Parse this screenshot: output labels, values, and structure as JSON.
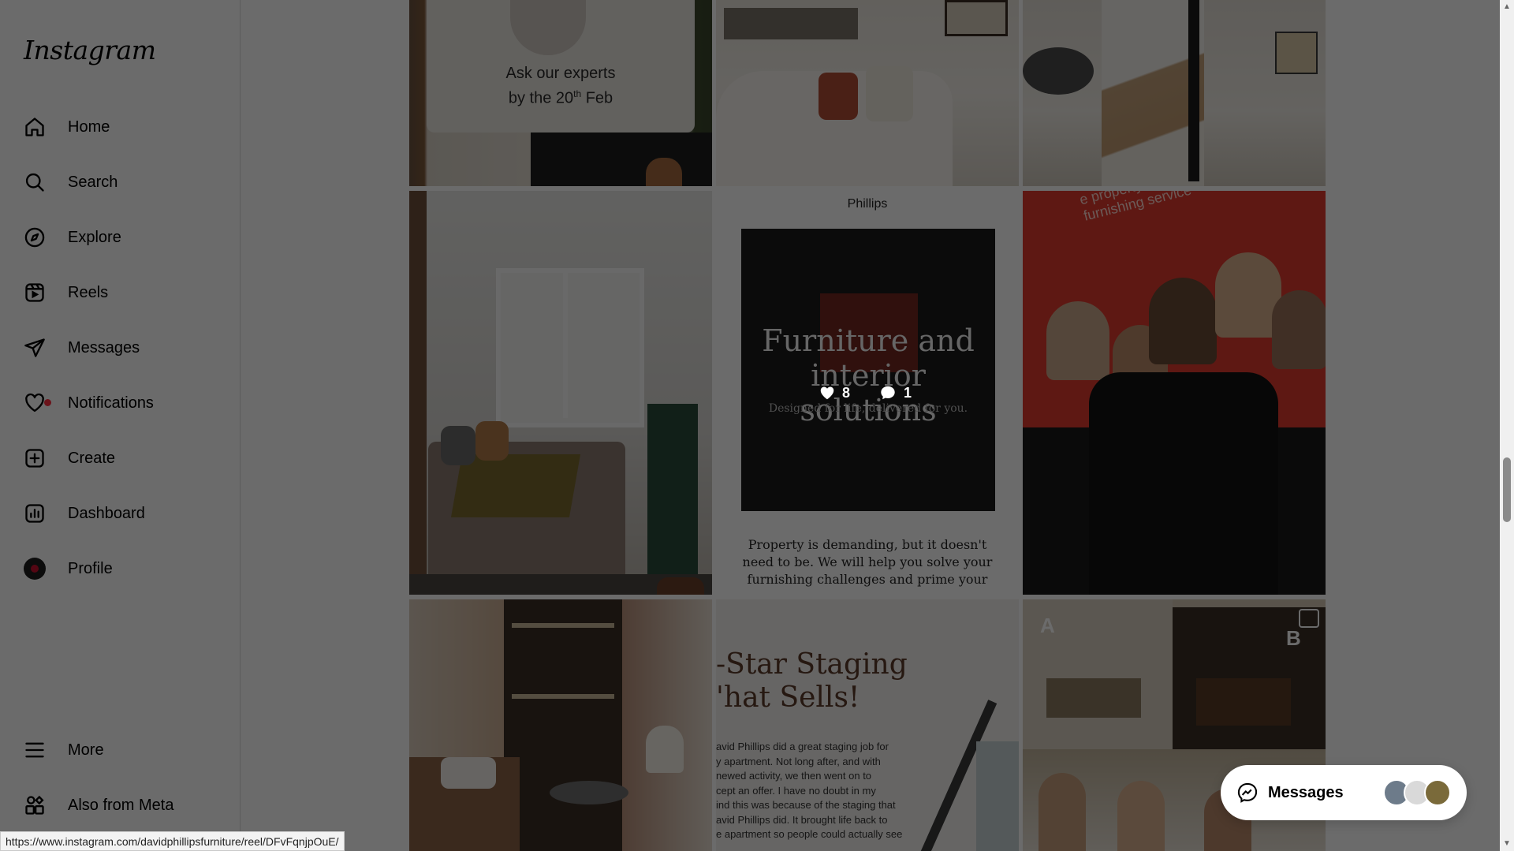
{
  "app": {
    "logo_text": "Instagram"
  },
  "sidebar": {
    "items": [
      {
        "label": "Home",
        "icon": "home-icon"
      },
      {
        "label": "Search",
        "icon": "search-icon"
      },
      {
        "label": "Explore",
        "icon": "compass-icon"
      },
      {
        "label": "Reels",
        "icon": "reels-icon"
      },
      {
        "label": "Messages",
        "icon": "paper-plane-icon"
      },
      {
        "label": "Notifications",
        "icon": "heart-icon"
      },
      {
        "label": "Create",
        "icon": "plus-square-icon"
      },
      {
        "label": "Dashboard",
        "icon": "dashboard-icon"
      },
      {
        "label": "Profile",
        "icon": "avatar"
      }
    ],
    "more_label": "More",
    "meta_label": "Also from Meta"
  },
  "posts": {
    "tile1_text_line1": "Ask our experts",
    "tile1_text_line2": "by the 20",
    "tile1_text_sup": "th",
    "tile1_text_end": " Feb",
    "tile5_brand": "Phillips",
    "tile5_heading_line1": "Furniture and",
    "tile5_heading_line2": "interior solutions",
    "tile5_sub": "Designed for life, delivered for you.",
    "tile5_body_line1": "Property is demanding, but it doesn't",
    "tile5_body_line2": "need to be. We will help you solve your",
    "tile5_body_line3": "furnishing challenges and prime your",
    "tile6_text": "e property market's premier furnishing service",
    "tile8_title_line1": "-Star Staging",
    "tile8_title_line2": "'hat Sells!",
    "tile8_body": [
      "avid Phillips did a great staging job for",
      "y apartment. Not long after, and with",
      "newed activity, we then went on to",
      "cept an offer. I have no doubt in my",
      "ind this was because of the staging that",
      "avid Phillips did. It brought life back to",
      "e apartment so people could actually see"
    ],
    "tile9_label_a": "A",
    "tile9_label_b": "B"
  },
  "hover_stats": {
    "likes": "8",
    "comments": "1"
  },
  "messages_pill": {
    "label": "Messages"
  },
  "status_url": "https://www.instagram.com/davidphillipsfurniture/reel/DFvFqnjpOuE/",
  "colors": {
    "notification": "#ff3040",
    "brand_red": "#c8102e"
  }
}
